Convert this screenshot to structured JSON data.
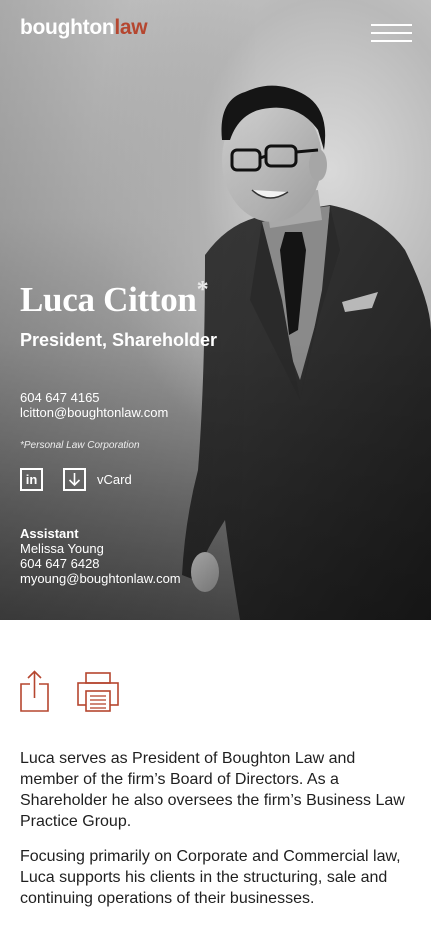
{
  "header": {
    "logo": {
      "text_part1": "boughton",
      "text_part2": "law",
      "color_accent": "#b5462f"
    },
    "menu_icon": "hamburger-menu-icon"
  },
  "profile": {
    "name": "Luca Citton",
    "name_marker": "*",
    "role": "President, Shareholder",
    "phone": "604 647 4165",
    "email": "lcitton@boughtonlaw.com",
    "corporation_note": "*Personal Law Corporation",
    "linkedin_label": "in",
    "vcard_label": "vCard"
  },
  "assistant": {
    "title": "Assistant",
    "name": "Melissa Young",
    "phone": "604 647 6428",
    "email": "myoung@boughtonlaw.com"
  },
  "tools": {
    "share_icon": "share-icon",
    "print_icon": "print-icon",
    "icon_color": "#b5462f"
  },
  "bio": {
    "paragraphs": [
      "Luca serves as President of Boughton Law and member of the firm’s Board of Directors. As a Shareholder he also oversees the firm’s Business Law Practice Group.",
      "Focusing primarily on Corporate and Commercial law, Luca supports his clients in the structuring, sale and continuing operations of their businesses."
    ]
  }
}
